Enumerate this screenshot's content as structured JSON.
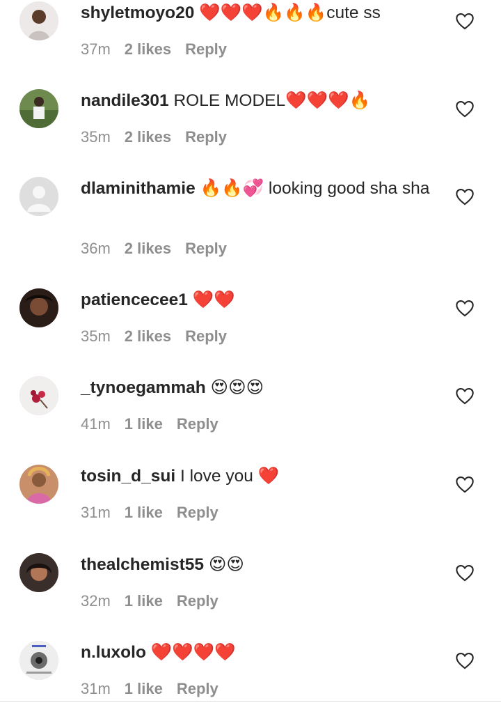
{
  "comments": [
    {
      "username": "shyletmoyo20",
      "text": "❤️❤️❤️🔥🔥🔥cute ss",
      "time": "37m",
      "likes": "2 likes",
      "reply": "Reply",
      "avatar": "profile-photo"
    },
    {
      "username": "nandile301",
      "text": "ROLE MODEL❤️❤️❤️🔥",
      "time": "35m",
      "likes": "2 likes",
      "reply": "Reply",
      "avatar": "profile-photo"
    },
    {
      "username": "dlaminithamie",
      "text": "🔥🔥💞 looking good sha sha",
      "time": "36m",
      "likes": "2 likes",
      "reply": "Reply",
      "avatar": "default-avatar"
    },
    {
      "username": "patiencecee1",
      "text": "❤️❤️",
      "time": "35m",
      "likes": "2 likes",
      "reply": "Reply",
      "avatar": "profile-photo"
    },
    {
      "username": "_tynoegammah",
      "text": "😍😍😍",
      "time": "41m",
      "likes": "1 like",
      "reply": "Reply",
      "avatar": "flower-photo"
    },
    {
      "username": "tosin_d_sui",
      "text": "I love you ❤️",
      "time": "31m",
      "likes": "1 like",
      "reply": "Reply",
      "avatar": "profile-photo"
    },
    {
      "username": "thealchemist55",
      "text": "😍😍",
      "time": "32m",
      "likes": "1 like",
      "reply": "Reply",
      "avatar": "profile-photo"
    },
    {
      "username": "n.luxolo",
      "text": "❤️❤️❤️❤️",
      "time": "31m",
      "likes": "1 like",
      "reply": "Reply",
      "avatar": "poster-photo"
    }
  ],
  "colors": {
    "text": "#262626",
    "meta": "#8e8e8e",
    "heart_outline": "#262626",
    "background": "#ffffff"
  },
  "icons": {
    "like": "heart-outline-icon"
  }
}
